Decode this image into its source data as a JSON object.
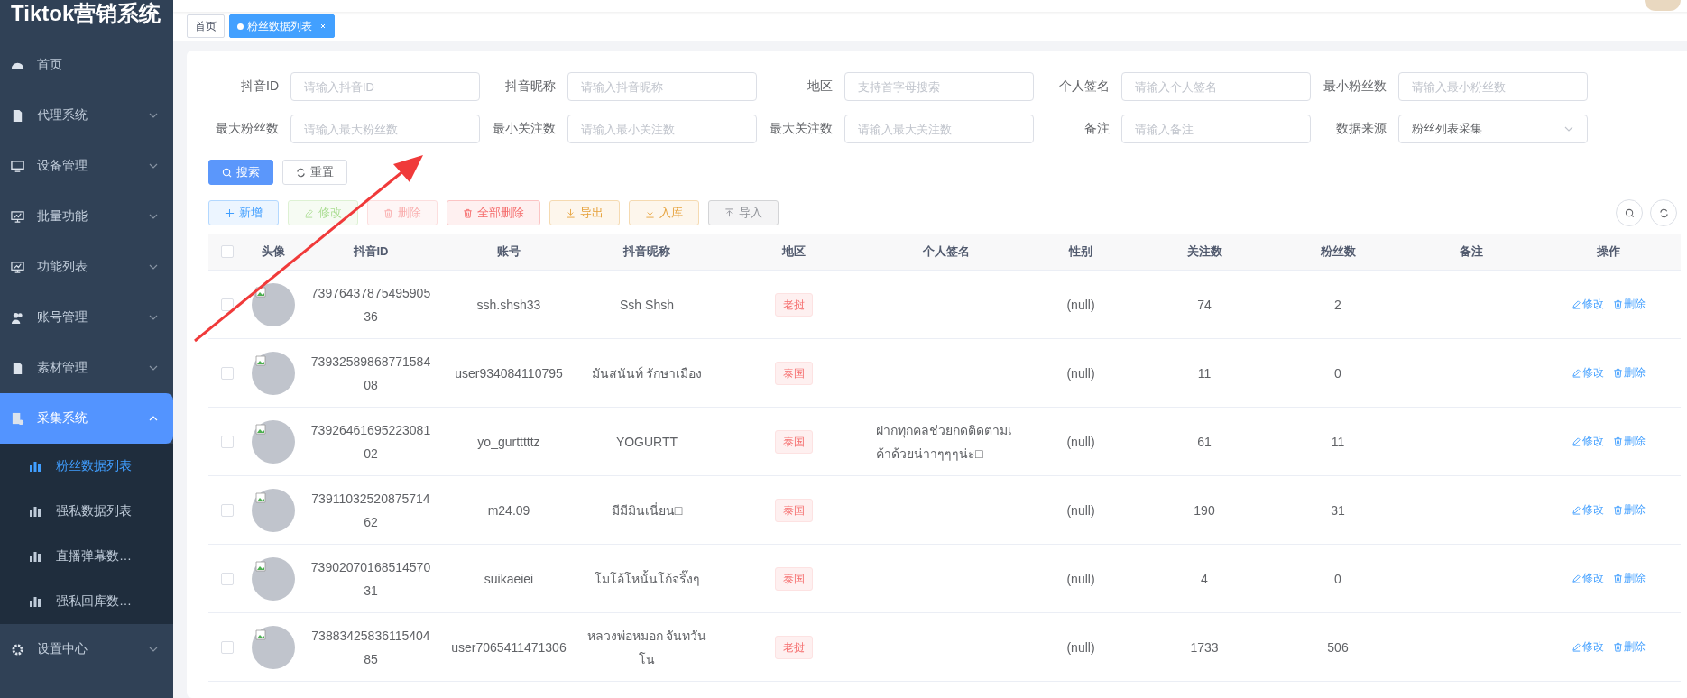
{
  "sidebar": {
    "title": "Tiktok营销系统",
    "items": [
      {
        "label": "首页",
        "kind": "dashboard",
        "selected": false
      },
      {
        "label": "代理系统",
        "kind": "document",
        "selected": false,
        "expanded": false
      },
      {
        "label": "设备管理",
        "kind": "monitor",
        "selected": false,
        "expanded": false
      },
      {
        "label": "批量功能",
        "kind": "chart-monitor",
        "selected": false,
        "expanded": false
      },
      {
        "label": "功能列表",
        "kind": "chart-monitor",
        "selected": false,
        "expanded": false
      },
      {
        "label": "账号管理",
        "kind": "users",
        "selected": false,
        "expanded": false
      },
      {
        "label": "素材管理",
        "kind": "document",
        "selected": false,
        "expanded": false
      },
      {
        "label": "采集系统",
        "kind": "collect",
        "selected": true,
        "expanded": true,
        "children": [
          {
            "label": "粉丝数据列表",
            "selected": true
          },
          {
            "label": "强私数据列表",
            "selected": false
          },
          {
            "label": "直播弹幕数…",
            "selected": false
          },
          {
            "label": "强私回库数…",
            "selected": false
          }
        ]
      },
      {
        "label": "设置中心",
        "kind": "gear",
        "selected": false,
        "expanded": false
      }
    ]
  },
  "tabs": [
    {
      "label": "首页",
      "selected": false
    },
    {
      "label": "粉丝数据列表",
      "selected": true
    }
  ],
  "filters": [
    {
      "label": "抖音ID",
      "placeholder": "请输入抖音ID"
    },
    {
      "label": "抖音昵称",
      "placeholder": "请输入抖音昵称"
    },
    {
      "label": "地区",
      "placeholder": "支持首字母搜索"
    },
    {
      "label": "个人签名",
      "placeholder": "请输入个人签名"
    },
    {
      "label": "最小粉丝数",
      "placeholder": "请输入最小粉丝数"
    },
    {
      "label": "最大粉丝数",
      "placeholder": "请输入最大粉丝数"
    },
    {
      "label": "最小关注数",
      "placeholder": "请输入最小关注数"
    },
    {
      "label": "最大关注数",
      "placeholder": "请输入最大关注数"
    },
    {
      "label": "备注",
      "placeholder": "请输入备注"
    },
    {
      "label": "数据来源",
      "value": "粉丝列表采集",
      "kind": "select"
    }
  ],
  "search_buttons": [
    {
      "label": "搜索",
      "kind": "primary"
    },
    {
      "label": "重置",
      "kind": "default"
    }
  ],
  "toolbar": [
    {
      "label": "新增",
      "kind": "primary",
      "disabled": false
    },
    {
      "label": "修改",
      "kind": "success",
      "disabled": true
    },
    {
      "label": "删除",
      "kind": "danger",
      "disabled": true
    },
    {
      "label": "全部删除",
      "kind": "danger",
      "disabled": false
    },
    {
      "label": "导出",
      "kind": "warning",
      "disabled": false
    },
    {
      "label": "入库",
      "kind": "warning",
      "disabled": false
    },
    {
      "label": "导入",
      "kind": "info",
      "disabled": false
    }
  ],
  "table": {
    "select_all": {
      "checked": false
    },
    "columns": [
      "头像",
      "抖音ID",
      "账号",
      "抖音昵称",
      "地区",
      "个人签名",
      "性别",
      "关注数",
      "粉丝数",
      "备注",
      "操作"
    ],
    "rows": [
      {
        "checked": false,
        "id": "7397643787549590536",
        "account": "ssh.shsh33",
        "nickname": "Ssh Shsh",
        "region": "老挝",
        "gender": "(null)",
        "follows": "74",
        "fans": "2",
        "actions": [
          {
            "label": "修改",
            "kind": "edit"
          },
          {
            "label": "删除",
            "kind": "delete"
          }
        ]
      },
      {
        "checked": false,
        "id": "7393258986877158408",
        "account": "user934084110795",
        "nickname": "มันสนันท์ รักษาเมือง",
        "region": "泰国",
        "gender": "(null)",
        "follows": "11",
        "fans": "0",
        "actions": [
          {
            "label": "修改",
            "kind": "edit"
          },
          {
            "label": "删除",
            "kind": "delete"
          }
        ]
      },
      {
        "checked": false,
        "id": "7392646169522308102",
        "account": "yo_gurtttttz",
        "nickname": "YOGURTT",
        "region": "泰国",
        "signature": "ฝากทุกคลช่วยกดติดตามเค้าด้วยน่าาๆๆๆน่ะ□",
        "gender": "(null)",
        "follows": "61",
        "fans": "11",
        "actions": [
          {
            "label": "修改",
            "kind": "edit"
          },
          {
            "label": "删除",
            "kind": "delete"
          }
        ]
      },
      {
        "checked": false,
        "id": "7391103252087571462",
        "account": "m24.09",
        "nickname": "มีมีมินเนี่ยน□",
        "region": "泰国",
        "gender": "(null)",
        "follows": "190",
        "fans": "31",
        "actions": [
          {
            "label": "修改",
            "kind": "edit"
          },
          {
            "label": "删除",
            "kind": "delete"
          }
        ]
      },
      {
        "checked": false,
        "id": "7390207016851457031",
        "account": "suikaeiei",
        "nickname": "โมโอ้โหนั้นโก้จริ๊งๆ",
        "region": "泰国",
        "gender": "(null)",
        "follows": "4",
        "fans": "0",
        "actions": [
          {
            "label": "修改",
            "kind": "edit"
          },
          {
            "label": "删除",
            "kind": "delete"
          }
        ]
      },
      {
        "checked": false,
        "id": "7388342583611540485",
        "account": "user7065411471306",
        "nickname": "หลวงพ่อหมอก จันทวันโน",
        "region": "老挝",
        "gender": "(null)",
        "follows": "1733",
        "fans": "506",
        "actions": [
          {
            "label": "修改",
            "kind": "edit"
          },
          {
            "label": "删除",
            "kind": "delete"
          }
        ]
      }
    ]
  }
}
